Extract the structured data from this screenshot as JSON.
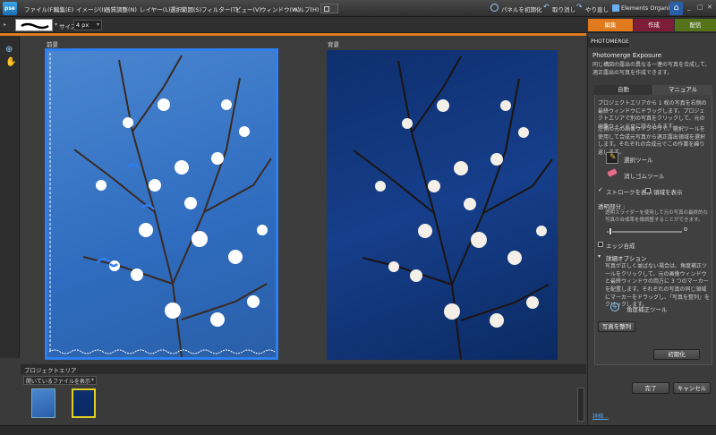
{
  "app": {
    "logo": "pse"
  },
  "menu": [
    "ファイル(F)",
    "編集(E)",
    "イメージ(I)",
    "画質調整(N)",
    "レイヤー(L)",
    "選択範囲(S)",
    "フィルター(T)",
    "ビュー(V)",
    "ウィンドウ(W)",
    "ヘルプ(H)"
  ],
  "toolbar_right": {
    "panel_reset": "パネルを初期化",
    "undo": "取り消し",
    "redo": "やり直し",
    "organizer": "Elements Organizer"
  },
  "options": {
    "size_label": "サイズ :",
    "size_value": "4 px"
  },
  "mode_tabs": [
    {
      "label": "編集",
      "color": "#e07a1c"
    },
    {
      "label": "作成",
      "color": "#8a1f3c"
    },
    {
      "label": "配信",
      "color": "#5a7a1a"
    }
  ],
  "canvas": {
    "foreground_label": "前景",
    "background_label": "背景"
  },
  "project_bin": {
    "title": "プロジェクトエリア",
    "dropdown": "開いているファイルを表示"
  },
  "panel": {
    "tab": "PHOTOMERGE",
    "title": "Photomerge Exposure",
    "desc": "同じ構図の露出の異なる一連の写真を合成して、適正露出の写真を作成できます。",
    "subtabs": [
      "自動",
      "マニュアル"
    ],
    "instr1": "プロジェクトエリアから 1 枚の写真を右側の最終ウィンドウにドラッグします。プロジェクトエリアで別の写真をクリックして、元の画像ウィンドウに読み込みます。",
    "instr2": "左側の元の画像ウィンドウで、選択ツールを使用して合成元写真から適正露出領域を選択します。それぞれの合成元でこの作業を繰り返します。",
    "tool_select": "選択ツール",
    "tool_eraser": "消しゴムツール",
    "chk_show_strokes": "ストロークを表示",
    "chk_show_regions": "領域を表示",
    "opacity_label": "透明部分 :",
    "opacity_hint": "透明スライダーを使用して元の写真の最終的な写真の合成率を微調整することができます。",
    "opacity_value": 0.05,
    "edge_blend": "エッジ合成",
    "adv_options": "詳細オプション",
    "adv_text": "写真が正しく並ばない場合は、角度補正ツールをクリックして、元の画像ウィンドウと最終ウィンドウの両方に 3 つのマーカーを配置します。それぞれの写真の同じ領域にマーカーをドラッグし、「写真を整列」をクリックします。",
    "align_tool": "角度補正ツール",
    "align_button": "写真を整列",
    "reset_button": "初期化",
    "done_button": "完了",
    "cancel_button": "キャンセル",
    "help_link": "詳細..."
  }
}
